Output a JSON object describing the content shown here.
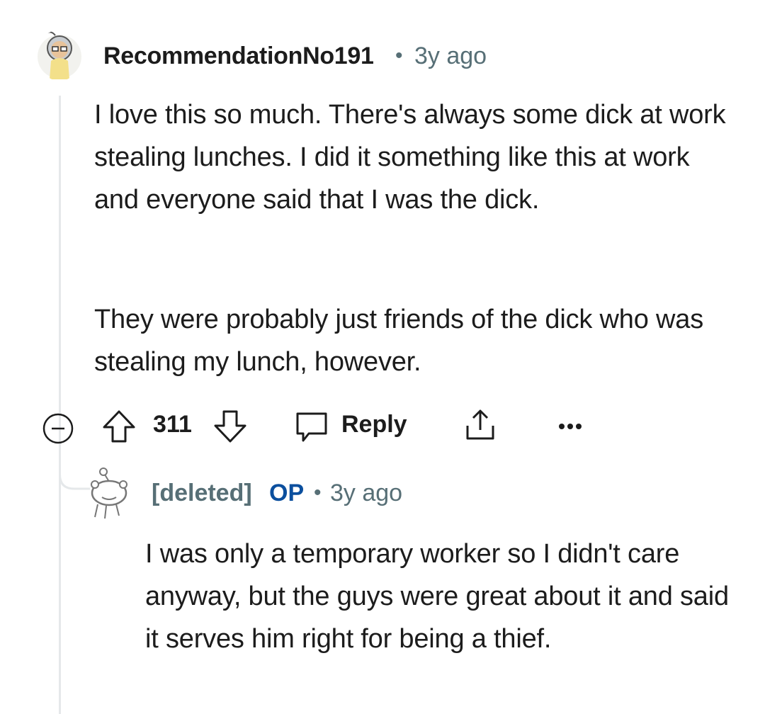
{
  "comment": {
    "username": "RecommendationNo191",
    "separator": "•",
    "timestamp": "3y ago",
    "paragraphs": [
      "I love this so much. There's always some dick at work stealing lunches. I did it something like this at work and everyone said that I was the dick.",
      "They were probably just friends of the dick who was stealing my lunch, however."
    ],
    "actions": {
      "score": "311",
      "reply_label": "Reply"
    }
  },
  "reply": {
    "username": "[deleted]",
    "op_badge": "OP",
    "separator": "•",
    "timestamp": "3y ago",
    "text": "I was only a temporary worker so I didn't care anyway, but the guys were great about it and said it serves him right for being a thief."
  },
  "colors": {
    "text": "#1c1c1c",
    "meta": "#576f76",
    "op": "#0b4f9e",
    "thread_line": "#e5e8ea"
  },
  "icons": [
    "user-avatar",
    "collapse-icon",
    "upvote-icon",
    "downvote-icon",
    "comment-icon",
    "share-icon",
    "more-icon",
    "deleted-user-avatar"
  ]
}
